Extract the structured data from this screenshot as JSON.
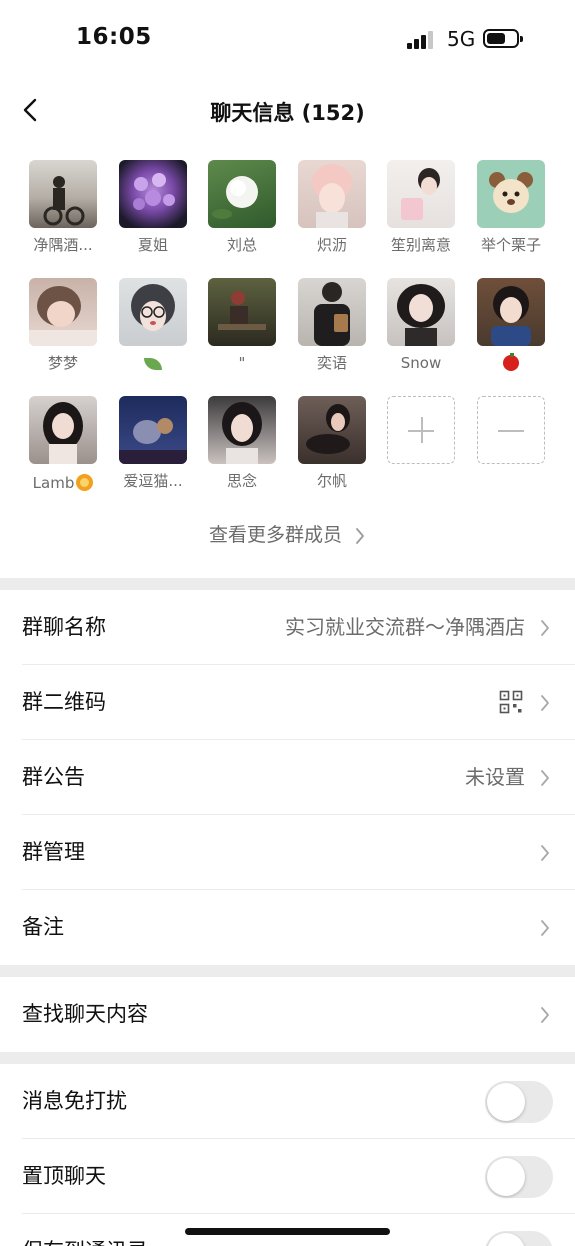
{
  "status_bar": {
    "time": "16:05",
    "network": "5G"
  },
  "nav": {
    "title": "聊天信息 (152)"
  },
  "members": [
    {
      "name": "净隅酒..."
    },
    {
      "name": "夏姐"
    },
    {
      "name": "刘总"
    },
    {
      "name": "炽沥"
    },
    {
      "name": "笙别离意"
    },
    {
      "name": "举个栗子"
    },
    {
      "name": "梦梦"
    },
    {
      "name": ""
    },
    {
      "name": "\""
    },
    {
      "name": "奕语"
    },
    {
      "name": "Snow"
    },
    {
      "name": ""
    },
    {
      "name": "Lamb"
    },
    {
      "name": "爱逗猫..."
    },
    {
      "name": "思念"
    },
    {
      "name": "尔帆"
    }
  ],
  "more_members": "查看更多群成员",
  "settings": {
    "group_name": {
      "label": "群聊名称",
      "value": "实习就业交流群～净隅酒店"
    },
    "qr_code": {
      "label": "群二维码"
    },
    "notice": {
      "label": "群公告",
      "value": "未设置"
    },
    "manage": {
      "label": "群管理"
    },
    "remark": {
      "label": "备注"
    },
    "search": {
      "label": "查找聊天内容"
    },
    "mute": {
      "label": "消息免打扰",
      "on": false
    },
    "pin": {
      "label": "置顶聊天",
      "on": false
    },
    "save": {
      "label": "保存到通讯录",
      "on": false
    }
  },
  "colors": {
    "divider_band": "#ececec",
    "secondary_text": "#6c6c6c",
    "toggle_off": "#e9e9ea"
  }
}
